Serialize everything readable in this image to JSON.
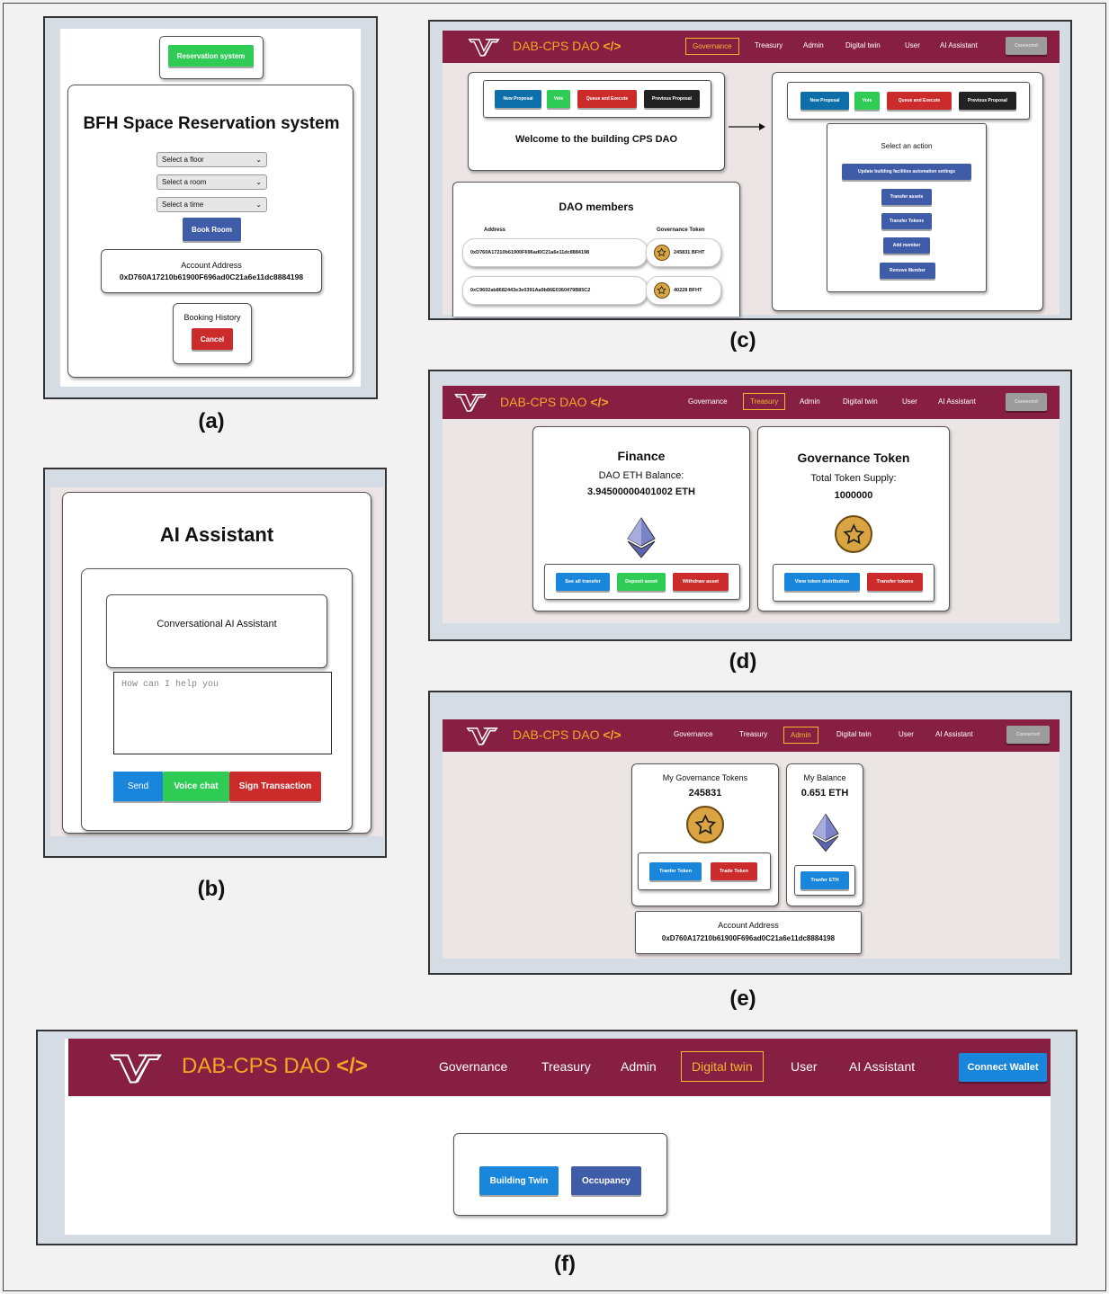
{
  "captions": {
    "a": "(a)",
    "b": "(b)",
    "c": "(c)",
    "d": "(d)",
    "e": "(e)",
    "f": "(f)"
  },
  "dao_nav": {
    "brand": "DAB-CPS DAO",
    "code_glyph": "</>",
    "logo": "VT",
    "items": [
      "Governance",
      "Treasury",
      "Admin",
      "Digital twin",
      "User",
      "AI Assistant"
    ],
    "connected_label": "Connected",
    "connect_wallet_label": "Connect Wallet"
  },
  "panel_a": {
    "reservation_button": "Reservation system",
    "title": "BFH Space Reservation system",
    "select_floor": "Select a floor",
    "select_room": "Select a room",
    "select_time": "Select a time",
    "book_room": "Book Room",
    "account_address_label": "Account Address",
    "account_address": "0xD760A17210b61900F696ad0C21a6e11dc8884198",
    "booking_history": "Booking History",
    "cancel": "Cancel"
  },
  "panel_b": {
    "title": "AI Assistant",
    "subtitle": "Conversational AI Assistant",
    "placeholder": "How can I help you",
    "send": "Send",
    "voice_chat": "Voice chat",
    "sign_transaction": "Sign Transaction"
  },
  "panel_c": {
    "buttons": {
      "new_proposal": "New Proposal",
      "vote": "Vote",
      "queue_execute": "Queue and Execute",
      "previous_proposal": "Previous Proposal"
    },
    "welcome": "Welcome to the building CPS DAO",
    "members_title": "DAO members",
    "address_header": "Address",
    "token_header": "Governance Token",
    "members": [
      {
        "address": "0xD760A17210b61900F696ad0C21a6e11dc8884198",
        "tokens": "245831 BFHT"
      },
      {
        "address": "0xC9602ab8682443e3e0391Aa9b86E0360479B85C2",
        "tokens": "40228 BFHT"
      }
    ],
    "select_action": "Select an action",
    "actions": [
      "Update building facilities automation settings",
      "Transfer assets",
      "Transfer Tokens",
      "Add member",
      "Remove Member"
    ]
  },
  "panel_d": {
    "finance_title": "Finance",
    "eth_balance_label": "DAO ETH Balance:",
    "eth_balance": "3.94500000401002 ETH",
    "see_all": "See all transfer",
    "deposit": "Deposit asset",
    "withdraw": "Withdraw asset",
    "gov_title": "Governance Token",
    "supply_label": "Total Token Supply:",
    "supply": "1000000",
    "view_distribution": "View token distribution",
    "transfer_tokens": "Transfer tokens"
  },
  "panel_e": {
    "my_tokens_label": "My Governance Tokens",
    "my_tokens": "245831",
    "transfer_token": "Tranfer Token",
    "trade_token": "Trade Token",
    "my_balance_label": "My Balance",
    "my_balance": "0.651 ETH",
    "transfer_eth": "Tranfer ETH",
    "account_address_label": "Account Address",
    "account_address": "0xD760A17210b61900F696ad0C21a6e11dc8884198"
  },
  "panel_f": {
    "building_twin": "Building Twin",
    "occupancy": "Occupancy"
  },
  "colors": {
    "maroon": "#861f41",
    "orange": "#f5a623",
    "green": "#2ecc55",
    "red": "#cc2b2b",
    "blue": "#1a86db",
    "navy": "#3f5ca8"
  }
}
